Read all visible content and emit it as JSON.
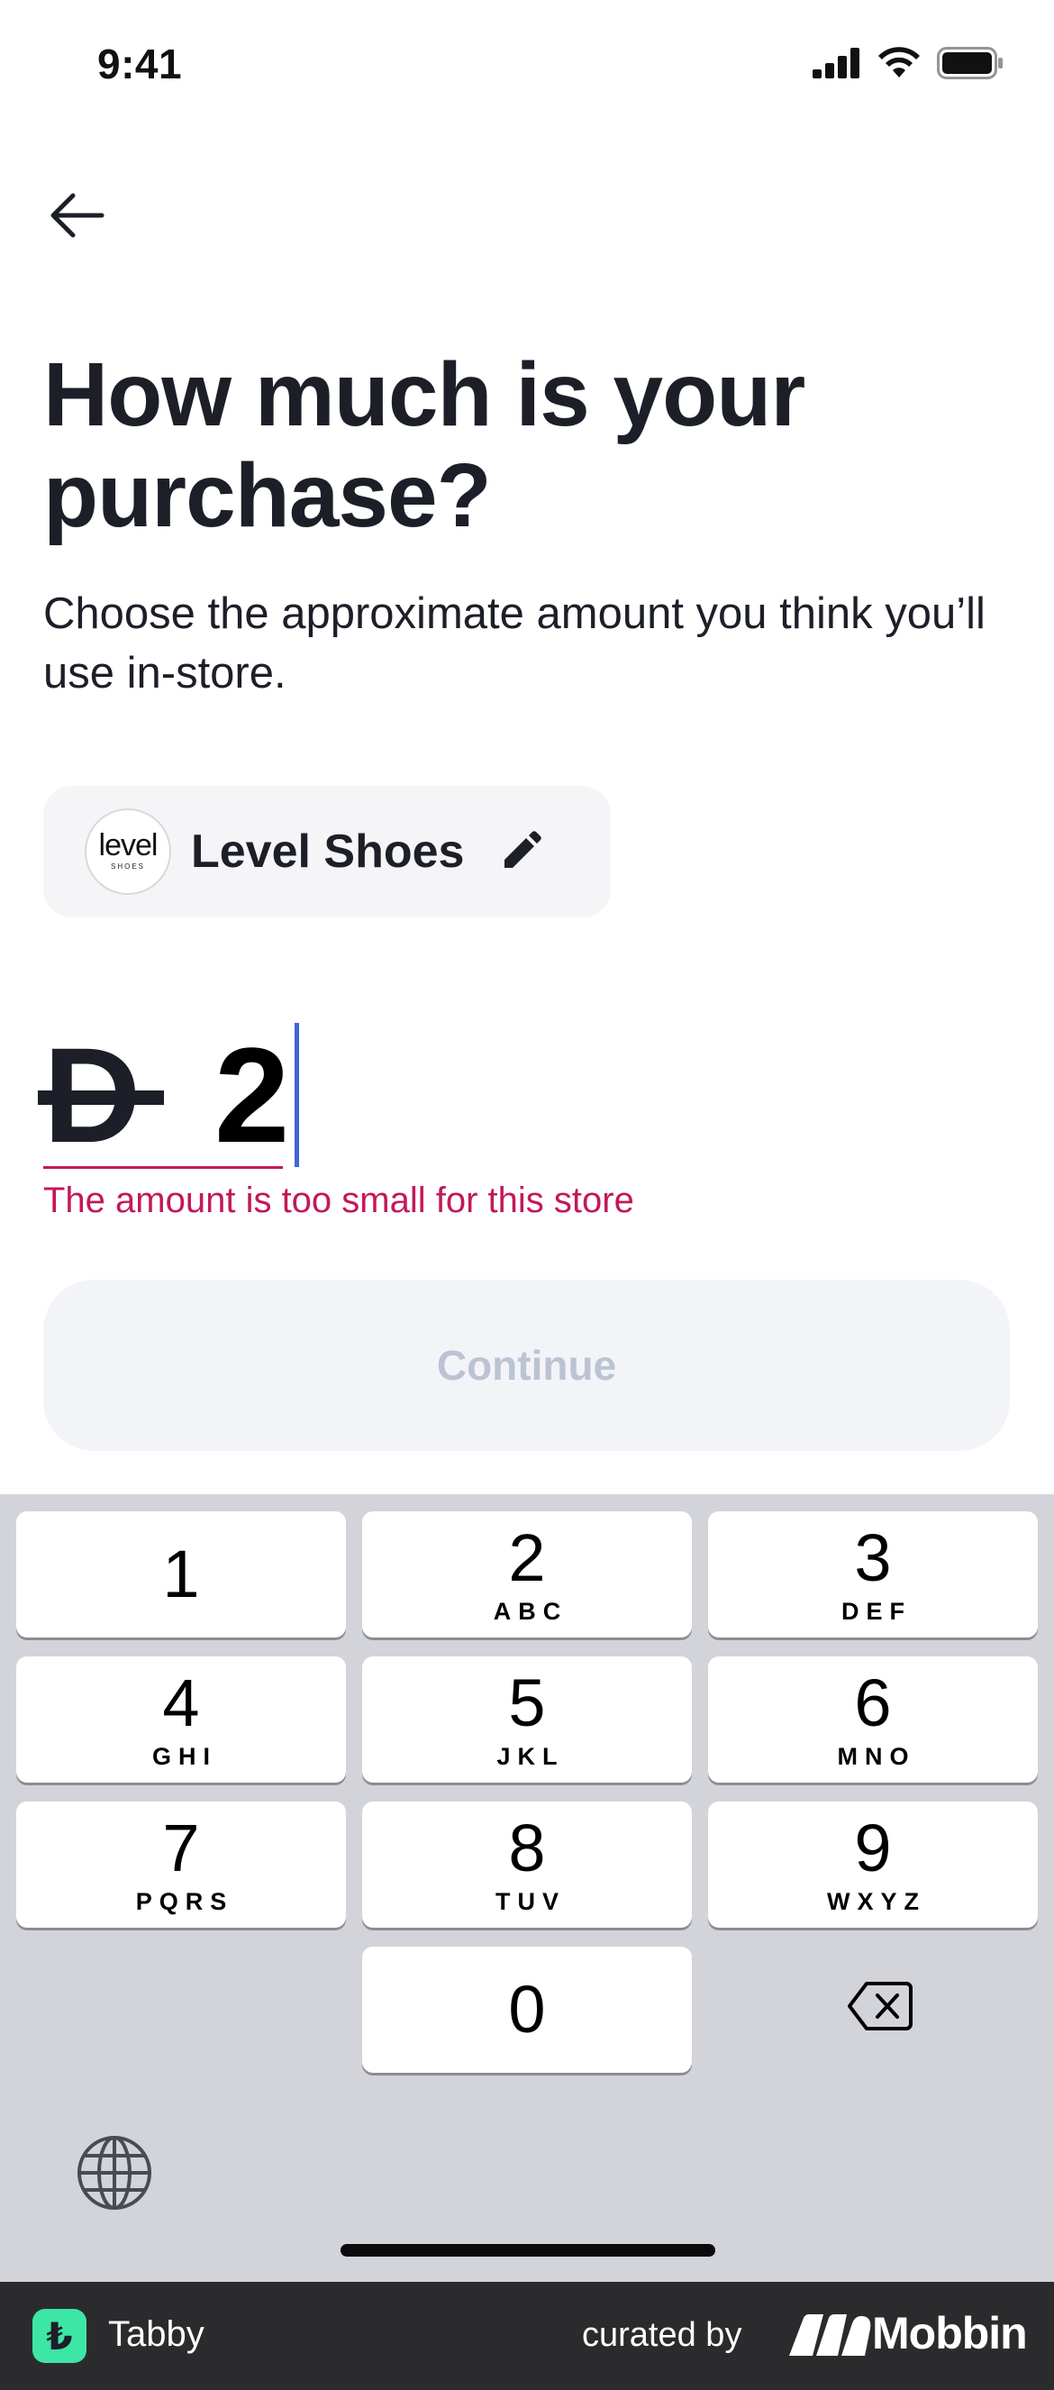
{
  "status_bar": {
    "time": "9:41"
  },
  "header": {
    "title": "How much is your purchase?",
    "subtitle": "Choose the approximate amount you think you’ll use in-store."
  },
  "store": {
    "name": "Level Shoes",
    "logo_main": "level",
    "logo_sub": "SHOES"
  },
  "amount": {
    "currency_symbol": "D",
    "value": "2",
    "error": "The amount is too small for this store"
  },
  "continue_label": "Continue",
  "keypad": {
    "keys": [
      {
        "digit": "1",
        "letters": ""
      },
      {
        "digit": "2",
        "letters": "ABC"
      },
      {
        "digit": "3",
        "letters": "DEF"
      },
      {
        "digit": "4",
        "letters": "GHI"
      },
      {
        "digit": "5",
        "letters": "JKL"
      },
      {
        "digit": "6",
        "letters": "MNO"
      },
      {
        "digit": "7",
        "letters": "PQRS"
      },
      {
        "digit": "8",
        "letters": "TUV"
      },
      {
        "digit": "9",
        "letters": "WXYZ"
      },
      {
        "digit": "0",
        "letters": ""
      }
    ]
  },
  "footer": {
    "app_name": "Tabby",
    "app_glyph": "₺",
    "curated_by": "curated by",
    "brand": "Mobbin"
  },
  "colors": {
    "error": "#c3185a",
    "tabby_green": "#3ee6a6",
    "cursor": "#3e67d6"
  }
}
